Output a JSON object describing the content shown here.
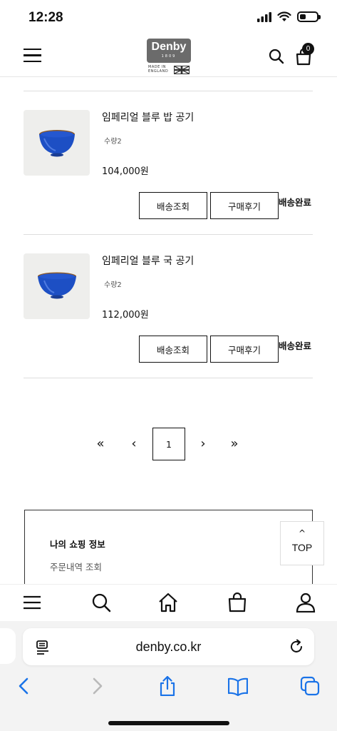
{
  "status": {
    "time": "12:28"
  },
  "header": {
    "logo_text": "Denby",
    "logo_year": "1809",
    "logo_made": "MADE IN\nENGLAND",
    "cart_count": "0"
  },
  "orders": [
    {
      "name": "임페리얼 블루 밥 공기",
      "qty": "수량2",
      "price": "104,000원",
      "track_label": "배송조회",
      "review_label": "구매후기",
      "status": "배송완료"
    },
    {
      "name": "임페리얼 블루 국 공기",
      "qty": "수량2",
      "price": "112,000원",
      "track_label": "배송조회",
      "review_label": "구매후기",
      "status": "배송완료"
    }
  ],
  "pagination": {
    "first": "«",
    "prev": "‹",
    "current": "1",
    "next": "›",
    "last": "»"
  },
  "shopping_info": {
    "title": "나의 쇼핑 정보",
    "link": "주문내역 조회"
  },
  "top_button": {
    "arrow": "^",
    "label": "TOP"
  },
  "browser": {
    "url": "denby.co.kr"
  },
  "colors": {
    "bowl_blue": "#1d4fc4",
    "bowl_rim": "#8a5a2b",
    "thumb_bg": "#eeeeec",
    "link_blue": "#1a73e8"
  },
  "icons": [
    "menu-icon",
    "search-icon",
    "cart-icon",
    "home-icon",
    "bag-icon",
    "user-icon",
    "share-icon",
    "bookmarks-icon",
    "tabs-icon",
    "back-icon",
    "forward-icon",
    "reload-icon",
    "reader-icon"
  ]
}
